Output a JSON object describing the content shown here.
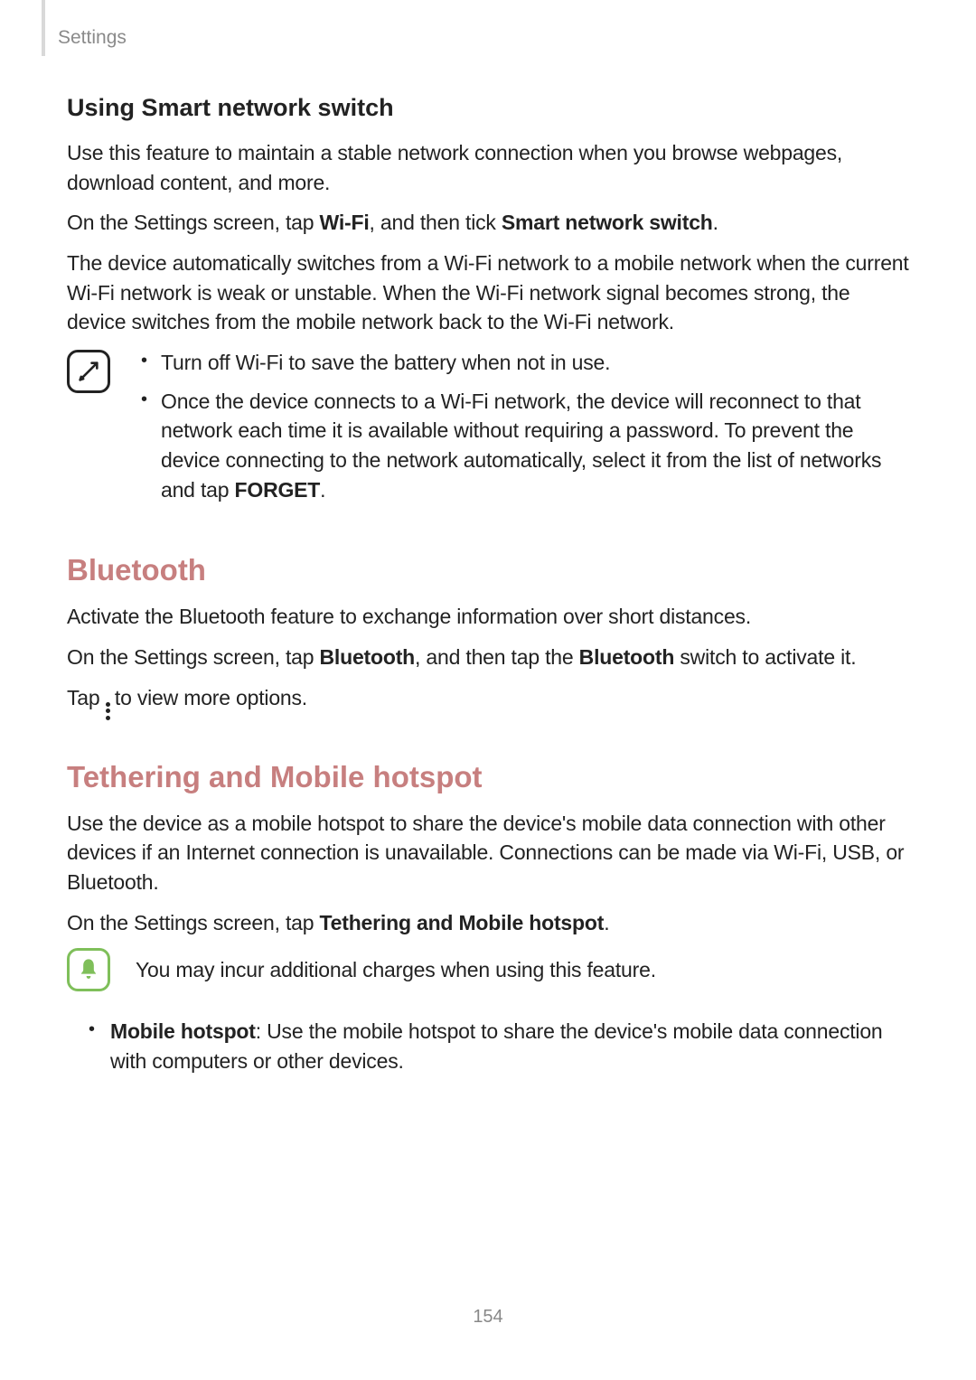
{
  "header": {
    "section": "Settings"
  },
  "sns": {
    "heading": "Using Smart network switch",
    "p1": "Use this feature to maintain a stable network connection when you browse webpages, download content, and more.",
    "p2_pre": "On the Settings screen, tap ",
    "p2_b1": "Wi-Fi",
    "p2_mid": ", and then tick ",
    "p2_b2": "Smart network switch",
    "p2_post": ".",
    "p3": "The device automatically switches from a Wi-Fi network to a mobile network when the current Wi-Fi network is weak or unstable. When the Wi-Fi network signal becomes strong, the device switches from the mobile network back to the Wi-Fi network."
  },
  "notes": {
    "li1": "Turn off Wi-Fi to save the battery when not in use.",
    "li2_pre": "Once the device connects to a Wi-Fi network, the device will reconnect to that network each time it is available without requiring a password. To prevent the device connecting to the network automatically, select it from the list of networks and tap ",
    "li2_b": "FORGET",
    "li2_post": "."
  },
  "bluetooth": {
    "heading": "Bluetooth",
    "p1": "Activate the Bluetooth feature to exchange information over short distances.",
    "p2_pre": "On the Settings screen, tap ",
    "p2_b1": "Bluetooth",
    "p2_mid": ", and then tap the ",
    "p2_b2": "Bluetooth",
    "p2_post": " switch to activate it.",
    "p3_pre": "Tap ",
    "p3_post": " to view more options."
  },
  "tether": {
    "heading": "Tethering and Mobile hotspot",
    "p1": "Use the device as a mobile hotspot to share the device's mobile data connection with other devices if an Internet connection is unavailable. Connections can be made via Wi-Fi, USB, or Bluetooth.",
    "p2_pre": "On the Settings screen, tap ",
    "p2_b": "Tethering and Mobile hotspot",
    "p2_post": ".",
    "caution": "You may incur additional charges when using this feature.",
    "li_b": "Mobile hotspot",
    "li_rest": ": Use the mobile hotspot to share the device's mobile data connection with computers or other devices."
  },
  "page_number": "154"
}
